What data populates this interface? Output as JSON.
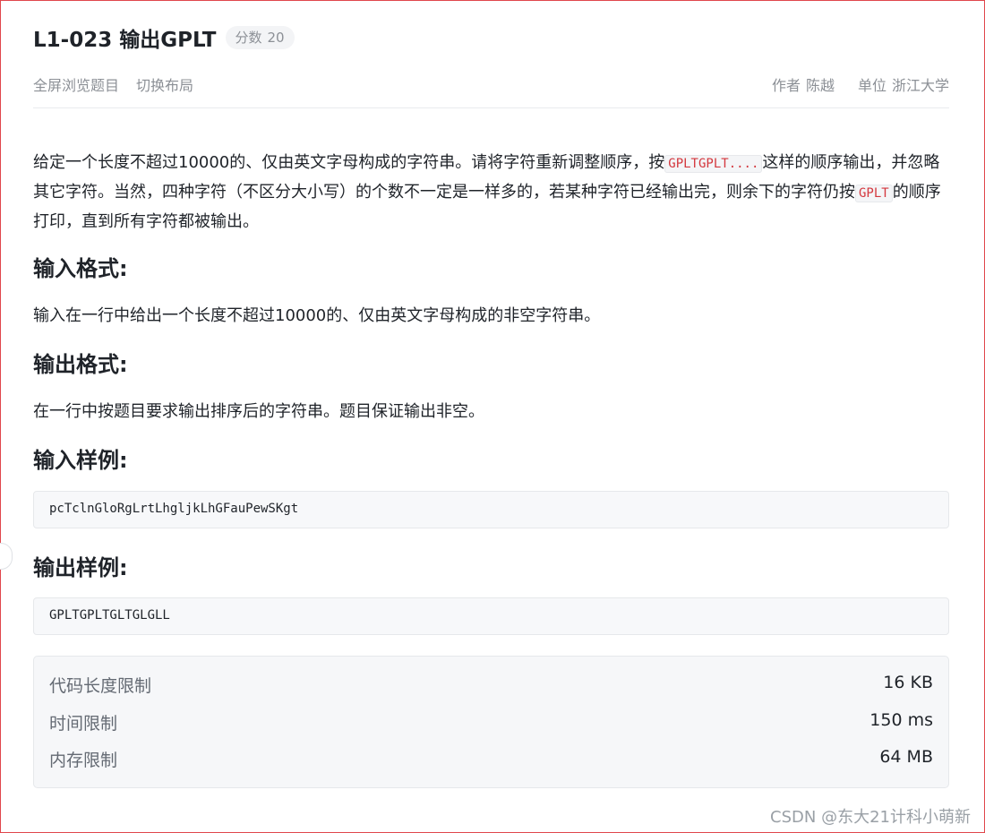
{
  "problem": {
    "title": "L1-023 输出GPLT",
    "score_label": "分数",
    "score_value": "20"
  },
  "toolbar": {
    "fullscreen": "全屏浏览题目",
    "switch_layout": "切换布局",
    "author_label": "作者",
    "author": "陈越",
    "org_label": "单位",
    "org": "浙江大学"
  },
  "description": {
    "part1": "给定一个长度不超过10000的、仅由英文字母构成的字符串。请将字符重新调整顺序，按",
    "code1": "GPLTGPLT....",
    "part2": "这样的顺序输出，并忽略其它字符。当然，四种字符（不区分大小写）的个数不一定是一样多的，若某种字符已经输出完，则余下的字符仍按",
    "code2": "GPLT",
    "part3": "的顺序打印，直到所有字符都被输出。"
  },
  "sections": {
    "input_format_heading": "输入格式:",
    "input_format_text": "输入在一行中给出一个长度不超过10000的、仅由英文字母构成的非空字符串。",
    "output_format_heading": "输出格式:",
    "output_format_text": "在一行中按题目要求输出排序后的字符串。题目保证输出非空。",
    "sample_input_heading": "输入样例:",
    "sample_input": "pcTclnGloRgLrtLhgljkLhGFauPewSKgt",
    "sample_output_heading": "输出样例:",
    "sample_output": "GPLTGPLTGLTGLGLL"
  },
  "limits": [
    {
      "label": "代码长度限制",
      "value": "16 KB"
    },
    {
      "label": "时间限制",
      "value": "150 ms"
    },
    {
      "label": "内存限制",
      "value": "64 MB"
    }
  ],
  "watermark": "CSDN @东大21计科小萌新",
  "colors": {
    "frame_border": "#e0474c",
    "inline_code": "#d4383e",
    "muted_text": "#8c9096"
  }
}
